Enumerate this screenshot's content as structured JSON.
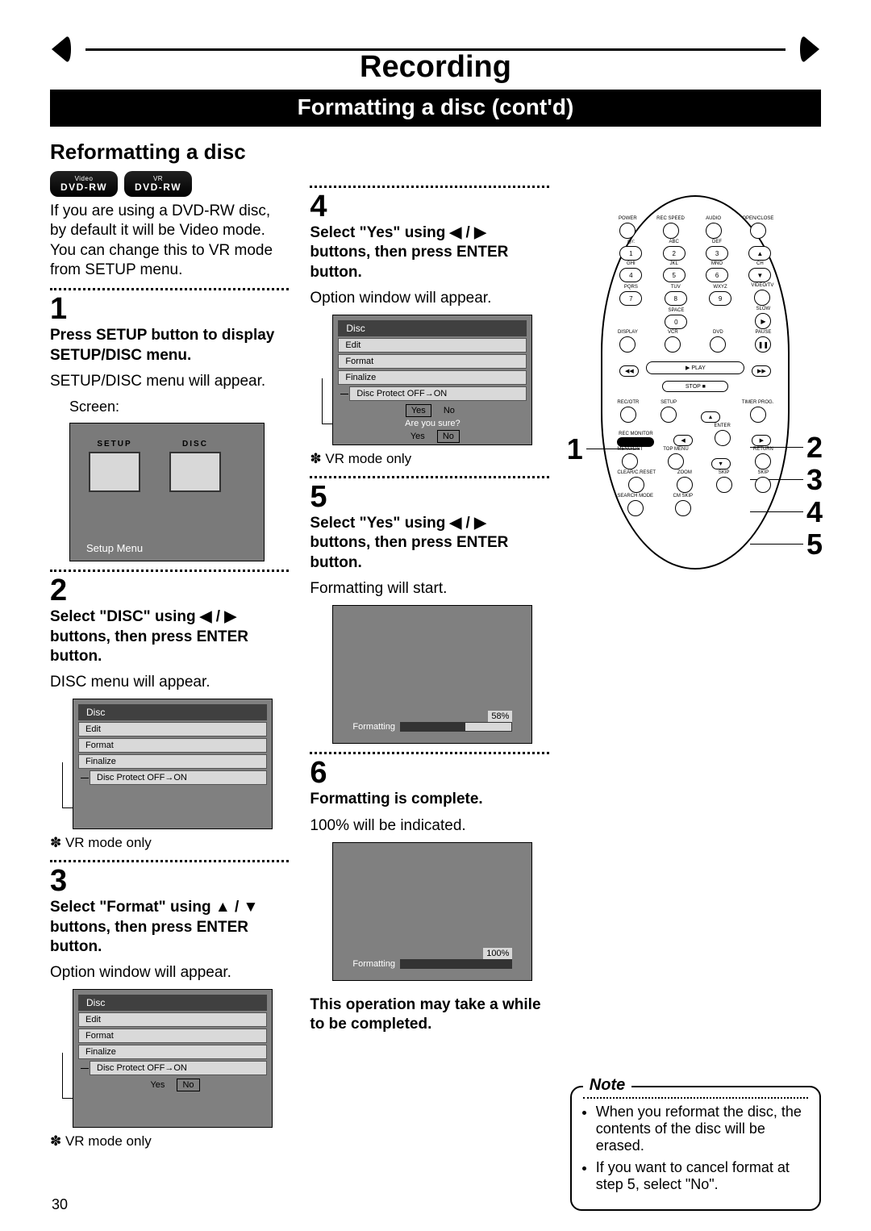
{
  "header": {
    "recording": "Recording",
    "subtitle": "Formatting a disc (cont'd)",
    "section": "Reformatting a disc"
  },
  "badges": [
    {
      "top": "Video",
      "bottom": "DVD-RW"
    },
    {
      "top": "VR",
      "bottom": "DVD-RW"
    }
  ],
  "intro": "If you are using a DVD-RW disc, by default it will be Video mode. You can change this to VR mode from SETUP menu.",
  "steps": {
    "s1": {
      "num": "1",
      "title": "Press SETUP button to display SETUP/DISC menu.",
      "body": "SETUP/DISC menu will appear.",
      "screen_label": "Screen:",
      "tabs": {
        "setup": "SETUP",
        "disc": "DISC"
      },
      "caption": "Setup Menu"
    },
    "s2": {
      "num": "2",
      "title": "Select \"DISC\" using ◀ / ▶ buttons, then press ENTER button.",
      "body": "DISC menu will appear.",
      "menu_title": "Disc",
      "items": [
        "Edit",
        "Format",
        "Finalize",
        "Disc Protect OFF→ON"
      ],
      "vr": "✽ VR mode only"
    },
    "s3": {
      "num": "3",
      "title": "Select \"Format\" using ▲ / ▼ buttons, then press ENTER button.",
      "body": "Option window will appear.",
      "menu_title": "Disc",
      "items": [
        "Edit",
        "Format",
        "Finalize",
        "Disc Protect OFF→ON"
      ],
      "yn_yes": "Yes",
      "yn_no": "No",
      "vr": "✽ VR mode only"
    },
    "s4": {
      "num": "4",
      "title": "Select \"Yes\" using ◀ / ▶ buttons, then press ENTER button.",
      "body": "Option window will appear.",
      "menu_title": "Disc",
      "items": [
        "Edit",
        "Format",
        "Finalize",
        "Disc Protect OFF→ON"
      ],
      "yn_yes": "Yes",
      "yn_no": "No",
      "ays": "Are you sure?",
      "ays_yes": "Yes",
      "ays_no": "No",
      "vr": "✽ VR mode only"
    },
    "s5": {
      "num": "5",
      "title": "Select \"Yes\" using ◀ / ▶ buttons, then press ENTER button.",
      "body": "Formatting will start.",
      "pct": "58%",
      "fmt": "Formatting"
    },
    "s6": {
      "num": "6",
      "title": "Formatting is complete.",
      "body": "100% will be indicated.",
      "pct": "100%",
      "fmt": "Formatting"
    },
    "warning": "This operation may take a while to be completed."
  },
  "remote": {
    "rows": [
      [
        "POWER",
        "REC SPEED",
        "AUDIO",
        "OPEN/CLOSE"
      ],
      [
        "@/:",
        "ABC",
        "DEF",
        ""
      ],
      [
        "1",
        "2",
        "3",
        "▲"
      ],
      [
        "GHI",
        "JKL",
        "MNO",
        "CH"
      ],
      [
        "4",
        "5",
        "6",
        "▼"
      ],
      [
        "PQRS",
        "TUV",
        "WXYZ",
        "VIDEO/TV"
      ],
      [
        "7",
        "8",
        "9",
        "●"
      ],
      [
        "",
        "SPACE",
        "",
        "SLOW"
      ],
      [
        "",
        "0",
        "",
        "▶"
      ],
      [
        "DISPLAY",
        "VCR",
        "DVD",
        "PAUSE"
      ],
      [
        "●",
        "⊙",
        "⊙",
        "❚❚"
      ]
    ],
    "play": "▶ PLAY",
    "rew": "◀◀",
    "ff": "▶▶",
    "stop": "STOP ■",
    "row2": [
      "REC/OTR",
      "SETUP",
      "",
      "TIMER PROG."
    ],
    "row3": [
      "REC MONITOR",
      "",
      "ENTER",
      ""
    ],
    "row4": [
      "MENU/LIST",
      "TOP MENU",
      "",
      "RETURN"
    ],
    "row5": [
      "CLEAR/C.RESET",
      "ZOOM",
      "SKIP",
      "SKIP"
    ],
    "row6": [
      "SEARCH MODE",
      "CM SKIP",
      "",
      ""
    ]
  },
  "side_numbers": {
    "left": "1",
    "right": [
      "2",
      "3",
      "4",
      "5"
    ]
  },
  "note": {
    "title": "Note",
    "items": [
      "When you reformat the disc, the contents of the disc will be erased.",
      "If you want to cancel format at step 5, select \"No\"."
    ]
  },
  "page_number": "30"
}
